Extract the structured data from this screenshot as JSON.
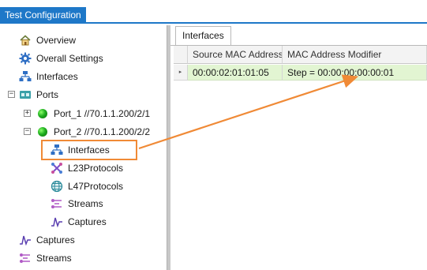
{
  "window": {
    "title": "Test Configuration"
  },
  "tree": {
    "overview": "Overview",
    "overall_settings": "Overall Settings",
    "interfaces": "Interfaces",
    "ports": "Ports",
    "port1": "Port_1 //70.1.1.200/2/1",
    "port2": "Port_2 //70.1.1.200/2/2",
    "port2_interfaces": "Interfaces",
    "port2_l23": "L23Protocols",
    "port2_l47": "L47Protocols",
    "port2_streams": "Streams",
    "port2_captures": "Captures",
    "captures": "Captures",
    "streams": "Streams",
    "expander_collapse": "−",
    "expander_expand": "+"
  },
  "panel": {
    "tab": "Interfaces",
    "columns": [
      "Source MAC Address",
      "MAC Address Modifier"
    ],
    "rows": [
      {
        "source_mac": "00:00:02:01:01:05",
        "modifier": "Step = 00:00:00:00:00:01"
      }
    ],
    "row_indicator": "▸"
  },
  "colors": {
    "accent": "#1e78c8",
    "highlight": "#f08a36",
    "row_bg": "#e2f5d2",
    "port_led": "#20b020"
  },
  "icons": {
    "overview": "home-icon",
    "overall_settings": "gear-icon",
    "interfaces": "network-icon",
    "ports": "ports-icon",
    "l23": "protocol-icon",
    "l47": "globe-icon",
    "streams": "streams-icon",
    "captures": "capture-wave-icon"
  }
}
